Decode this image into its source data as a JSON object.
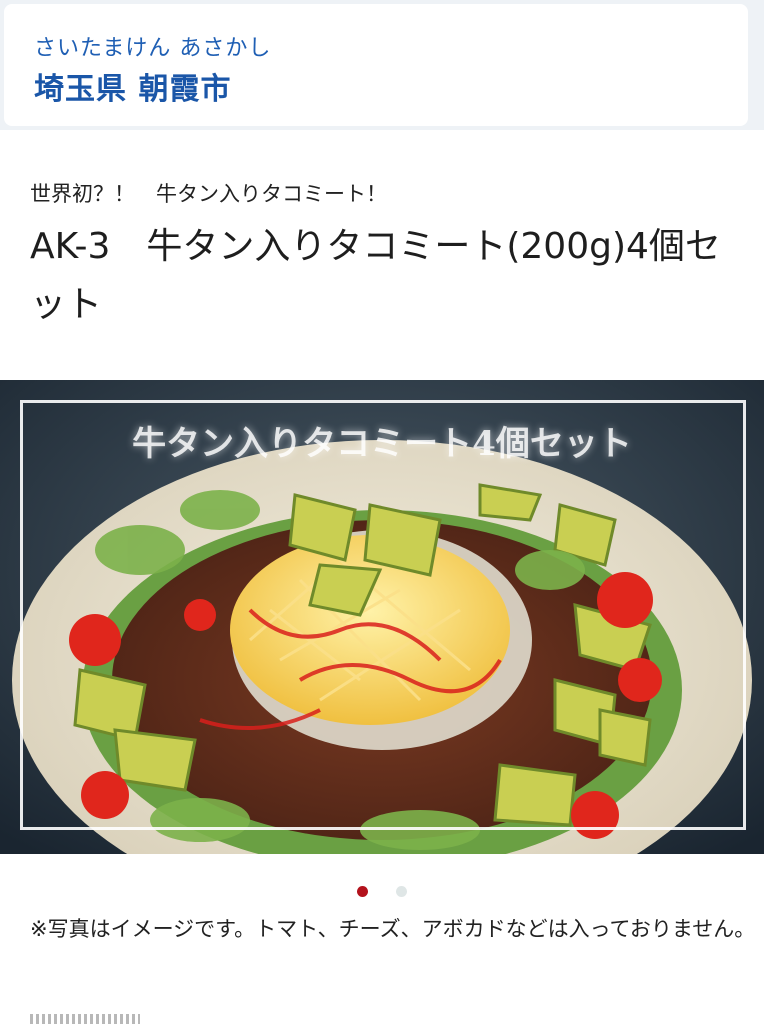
{
  "header": {
    "city_kana": "さいたまけん あさかし",
    "city_name": "埼玉県 朝霞市"
  },
  "product": {
    "subtitle": "世界初？！　牛タン入りタコミート！",
    "title": "AK-3　牛タン入りタコミート(200g)4個セット"
  },
  "carousel": {
    "overlay_text": "牛タン入りタコミート4個セット",
    "slides": 2,
    "active_index": 0
  },
  "note": "※写真はイメージです。トマト、チーズ、アボカドなどは入っておりません。",
  "colors": {
    "brand_blue": "#1a56a8",
    "dot_active": "#b3121c",
    "dot_inactive": "#dfe6e6"
  }
}
